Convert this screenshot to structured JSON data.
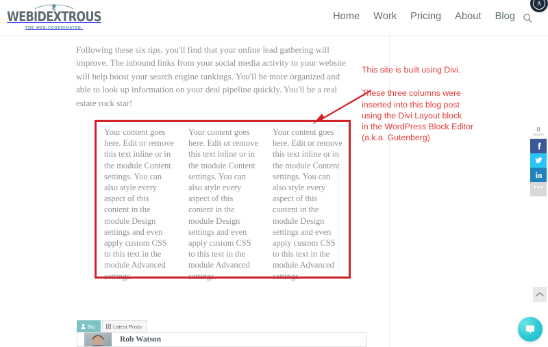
{
  "header": {
    "logo_word": "WEBIDEXTROUS",
    "logo_tagline": "THE WEB.COORDINATED.",
    "nav_items": [
      {
        "label": "Home"
      },
      {
        "label": "Work"
      },
      {
        "label": "Pricing"
      },
      {
        "label": "About"
      },
      {
        "label": "Blog"
      }
    ],
    "search_icon": "search-icon",
    "corner_badge_letter": "A"
  },
  "article": {
    "intro_paragraph": "Following these six tips, you'll find that your online lead gathering will improve. The inbound links from your social media activity to your website will help boost your search engine rankings. You'll be more organized and able to look up information on your deal pipeline quickly. You'll be a real estate rock star!"
  },
  "columns": [
    {
      "text": "Your content goes here. Edit or remove this text inline or in the module Content settings. You can also style every aspect of this content in the module Design settings and even apply custom CSS to this text in the module Advanced settings."
    },
    {
      "text": "Your content goes here. Edit or remove this text inline or in the module Content settings. You can also style every aspect of this content in the module Design settings and even apply custom CSS to this text in the module Advanced settings."
    },
    {
      "text": "Your content goes here. Edit or remove this text inline or in the module Content settings. You can also style every aspect of this content in the module Design settings and even apply custom CSS to this text in the module Advanced settings."
    }
  ],
  "annotation": {
    "color": "#e23b3b",
    "box_color": "#cf2026",
    "line1": "This site is built using Divi.",
    "block_lines": [
      "These three columns were",
      "inserted into this blog post",
      "using the Divi Layout block",
      "in the WordPress Block Editor",
      "(a.k.a. Gutenberg)"
    ]
  },
  "share": {
    "count": "0",
    "count_label": "Shares",
    "buttons": [
      {
        "name": "facebook-share-button",
        "icon": "facebook-icon",
        "color": "#3b5998"
      },
      {
        "name": "twitter-share-button",
        "icon": "twitter-icon",
        "color": "#29c5f6"
      },
      {
        "name": "linkedin-share-button",
        "icon": "linkedin-icon",
        "color": "#2083bc"
      },
      {
        "name": "more-share-button",
        "icon": "ellipsis-icon",
        "color": "#d8d8d8"
      }
    ]
  },
  "widgets": {
    "scroll_top_icon": "chevron-up-icon",
    "chat_icon": "chat-bubble-icon"
  },
  "author_box": {
    "tabs": [
      {
        "label": "Bio",
        "icon": "user-icon",
        "active": true
      },
      {
        "label": "Latest Posts",
        "icon": "document-icon",
        "active": false
      }
    ],
    "author_name": "Rob Watson",
    "avatar_icon": "avatar"
  }
}
